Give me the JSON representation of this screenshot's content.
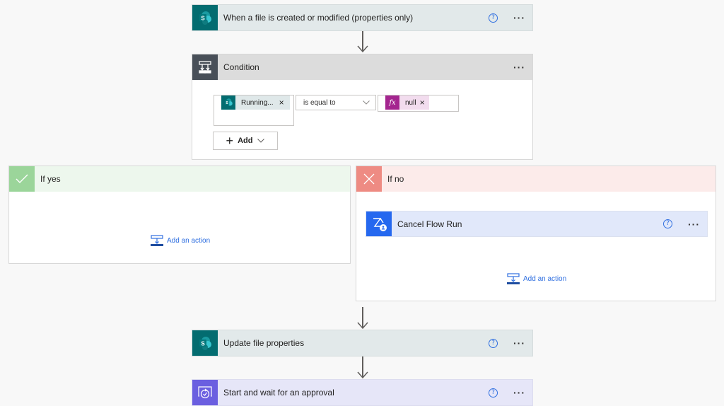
{
  "colors": {
    "sharepoint": "#036c70",
    "sharepoint_bg": "#e2e9ea",
    "condition": "#484f58",
    "condition_bg": "#dcdcdc",
    "yes": "#9bd59a",
    "yes_bg": "#edf7ed",
    "no": "#ee8b83",
    "no_bg": "#fcebea",
    "cancel": "#2568ef",
    "cancel_bg": "#e1e8fa",
    "approval": "#6b5fe0",
    "approval_bg": "#e6e6f8",
    "link": "#2f6fe0",
    "expression": "#a4258f"
  },
  "trigger": {
    "title": "When a file is created or modified (properties only)",
    "icon": "sharepoint-icon"
  },
  "condition": {
    "title": "Condition",
    "icon": "condition-icon",
    "left_token": "Running...",
    "operator": "is equal to",
    "right_token": "null",
    "right_token_icon": "fx",
    "add_label": "Add"
  },
  "branch_yes": {
    "title": "If yes",
    "add_action": "Add an action"
  },
  "branch_no": {
    "title": "If no",
    "actions": [
      {
        "title": "Cancel Flow Run",
        "icon": "cancel-flow-icon"
      }
    ],
    "add_action": "Add an action"
  },
  "steps": [
    {
      "title": "Update file properties",
      "icon": "sharepoint-icon"
    },
    {
      "title": "Start and wait for an approval",
      "icon": "approval-icon"
    }
  ],
  "help_glyph": "?",
  "more_glyph": "···",
  "close_glyph": "×"
}
